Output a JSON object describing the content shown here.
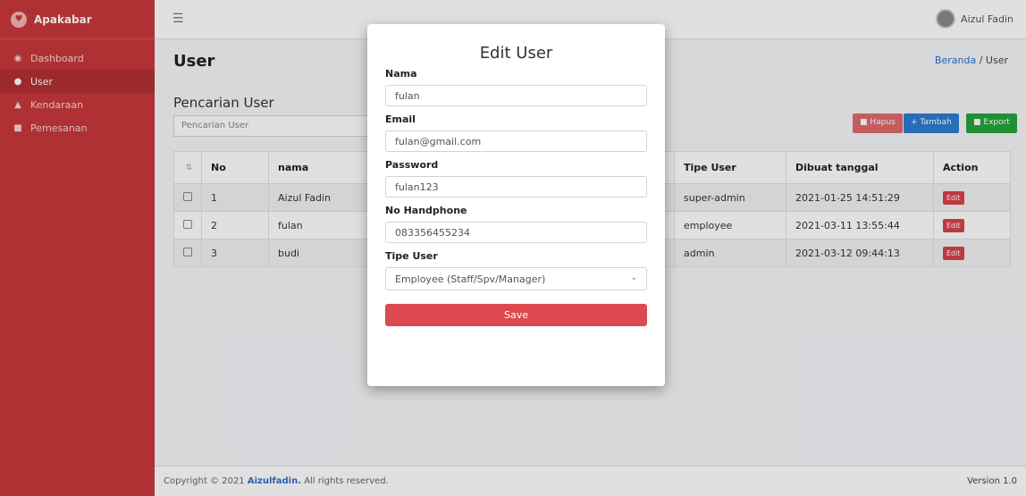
{
  "brand": {
    "name": "Apakabar",
    "logo_icon": "heart-icon"
  },
  "sidebar": {
    "items": [
      {
        "label": "Dashboard",
        "icon": "dashboard-icon"
      },
      {
        "label": "User",
        "icon": "users-icon",
        "active": true
      },
      {
        "label": "Kendaraan",
        "icon": "car-icon"
      },
      {
        "label": "Pemesanan",
        "icon": "clipboard-icon"
      }
    ]
  },
  "topbar": {
    "user_name": "Aizul Fadin"
  },
  "page": {
    "title": "User",
    "breadcrumb": {
      "home": "Beranda",
      "separator": "/",
      "current": "User"
    },
    "section_title": "Pencarian User",
    "search_placeholder": "Pencarian User",
    "buttons": {
      "hapus": "Hapus",
      "tambah": "Tambah",
      "export": "Export"
    }
  },
  "table": {
    "headers": [
      "No",
      "nama",
      "Tipe User",
      "Dibuat tanggal",
      "Action"
    ],
    "rows": [
      {
        "no": "1",
        "nama": "Aizul Fadin",
        "tipe": "super-admin",
        "dibuat": "2021-01-25 14:51:29",
        "action": "Edit"
      },
      {
        "no": "2",
        "nama": "fulan",
        "tipe": "employee",
        "dibuat": "2021-03-11 13:55:44",
        "action": "Edit"
      },
      {
        "no": "3",
        "nama": "budi",
        "tipe": "admin",
        "dibuat": "2021-03-12 09:44:13",
        "action": "Edit"
      }
    ]
  },
  "footer": {
    "copyright_prefix": "Copyright © 2021",
    "brand": "Aizulfadin.",
    "suffix": "All rights reserved.",
    "version": "Version 1.0"
  },
  "modal": {
    "title": "Edit User",
    "fields": {
      "nama": {
        "label": "Nama",
        "value": "fulan"
      },
      "email": {
        "label": "Email",
        "value": "fulan@gmail.com"
      },
      "password": {
        "label": "Password",
        "value": "fulan123"
      },
      "phone": {
        "label": "No Handphone",
        "value": "083356455234"
      },
      "tipe": {
        "label": "Tipe User",
        "value": "Employee (Staff/Spv/Manager)"
      }
    },
    "save_label": "Save"
  },
  "colors": {
    "sidebar": "#c9383b",
    "primary": "#2d7dd2",
    "danger": "#dc4a4f",
    "success": "#26a33b"
  }
}
